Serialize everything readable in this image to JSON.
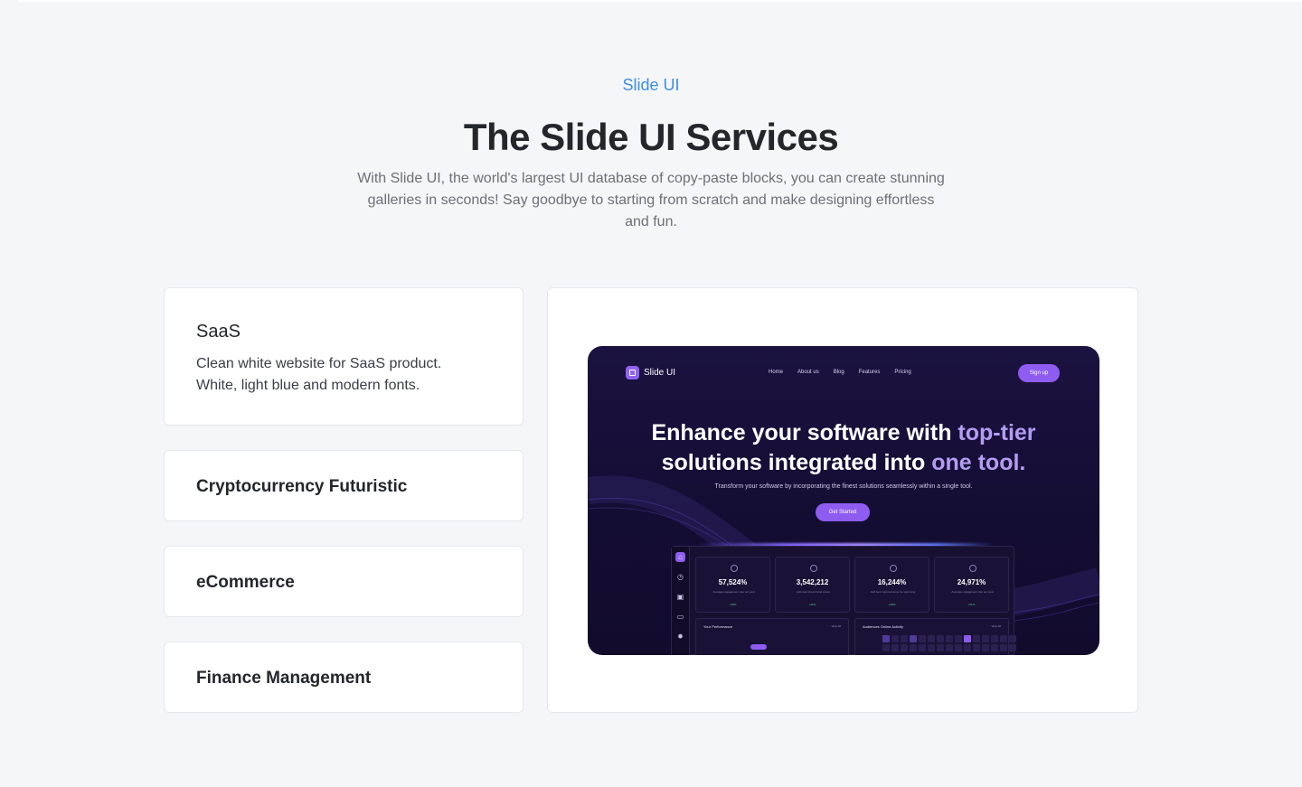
{
  "header": {
    "eyebrow": "Slide UI",
    "title": "The Slide UI Services",
    "subtitle": "With Slide UI, the world's largest UI database of copy-paste blocks, you can create stunning galleries in seconds! Say goodbye to starting from scratch and make designing effortless and fun."
  },
  "services": [
    {
      "title": "SaaS",
      "description": "Clean white website for SaaS product. White, light blue and modern fonts.",
      "active": true
    },
    {
      "title": "Cryptocurrency Futuristic",
      "description": "",
      "active": false
    },
    {
      "title": "eCommerce",
      "description": "",
      "active": false
    },
    {
      "title": "Finance Management",
      "description": "",
      "active": false
    }
  ],
  "preview": {
    "logo": "Slide UI",
    "nav": [
      "Home",
      "About us",
      "Blog",
      "Features",
      "Pricing"
    ],
    "signup": "Sign up",
    "headline_main": "Enhance your software with ",
    "headline_accent": "top-tier",
    "headline_line2_main": "solutions integrated into ",
    "headline_line2_accent": "one tool.",
    "subtext": "Transform your software by incorporating the finest solutions seamlessly within a single tool.",
    "cta": "Get Started",
    "stats": [
      {
        "value": "57,524%",
        "label": "Average engagement rate per post",
        "change": "+18%"
      },
      {
        "value": "3,542,212",
        "label": "Add new show brand colors",
        "change": "+42%"
      },
      {
        "value": "16,244%",
        "label": "Add best improvements for upcoming",
        "change": "+48%"
      },
      {
        "value": "24,971%",
        "label": "Average engagement rate per post",
        "change": "+51%"
      }
    ],
    "panels": [
      {
        "title": "Your Performance",
        "meta": "View All"
      },
      {
        "title": "Audiences Online Activity",
        "meta": "View All"
      }
    ]
  },
  "colors": {
    "accent": "#3b8ee8",
    "preview_bg": "#140d33",
    "preview_accent": "#8e5cf0"
  }
}
